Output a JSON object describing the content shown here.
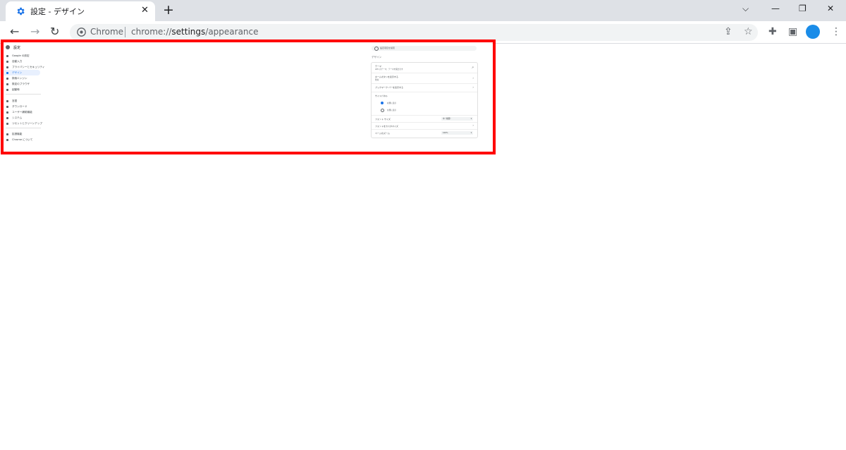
{
  "browser": {
    "tab": {
      "title": "設定 - デザイン",
      "close": "✕"
    },
    "new_tab": "+",
    "window_controls": {
      "tab_search": "⌵",
      "minimize": "—",
      "restore": "❐",
      "close": "✕"
    },
    "nav": {
      "back": "←",
      "forward": "→",
      "reload": "↻"
    },
    "omnibox": {
      "site": "Chrome",
      "url_prefix": "chrome://",
      "url_path": "settings",
      "url_suffix": "/appearance"
    },
    "toolbar_icons": {
      "share": "⇪",
      "bookmark": "☆",
      "extensions": "✚",
      "sidepanel": "▣",
      "menu": "⋮"
    },
    "profile_color": "#1a8ce8",
    "accent": "#1a73e8"
  },
  "settings": {
    "title": "設定",
    "nav_items": [
      {
        "label": "Google の設定",
        "icon": "person-icon"
      },
      {
        "label": "自動入力",
        "icon": "autofill-icon"
      },
      {
        "label": "プライバシーとセキュリティ",
        "icon": "shield-icon"
      },
      {
        "label": "デザイン",
        "icon": "palette-icon",
        "active": true
      },
      {
        "label": "検索エンジン",
        "icon": "search-icon"
      },
      {
        "label": "既定のブラウザ",
        "icon": "browser-icon"
      },
      {
        "label": "起動時",
        "icon": "power-icon"
      },
      {
        "label": "言語",
        "icon": "globe-icon"
      },
      {
        "label": "ダウンロード",
        "icon": "download-icon"
      },
      {
        "label": "ユーザー補助機能",
        "icon": "accessibility-icon"
      },
      {
        "label": "システム",
        "icon": "wrench-icon"
      },
      {
        "label": "リセットとクリーンアップ",
        "icon": "reset-icon"
      },
      {
        "label": "拡張機能",
        "icon": "extension-icon"
      },
      {
        "label": "Chrome について",
        "icon": "chrome-icon"
      }
    ],
    "search_placeholder": "設定項目を検索",
    "section_title": "デザイン",
    "rows": {
      "theme_label": "テーマ",
      "theme_sub": "GTK のテーマ、テーマを開きます",
      "home_label": "ホームボタンを表示する",
      "home_sub": "無効",
      "bookmarks_label": "ブックマーク バーを表示する",
      "sidepanel_label": "サイドパネル",
      "side_right": "右側に表示",
      "side_left": "左側に表示",
      "font_size_label": "フォント サイズ",
      "font_size_value": "中（推奨）",
      "customize_fonts_label": "フォントをカスタマイズ",
      "zoom_label": "ページのズーム",
      "zoom_value": "100%"
    }
  }
}
